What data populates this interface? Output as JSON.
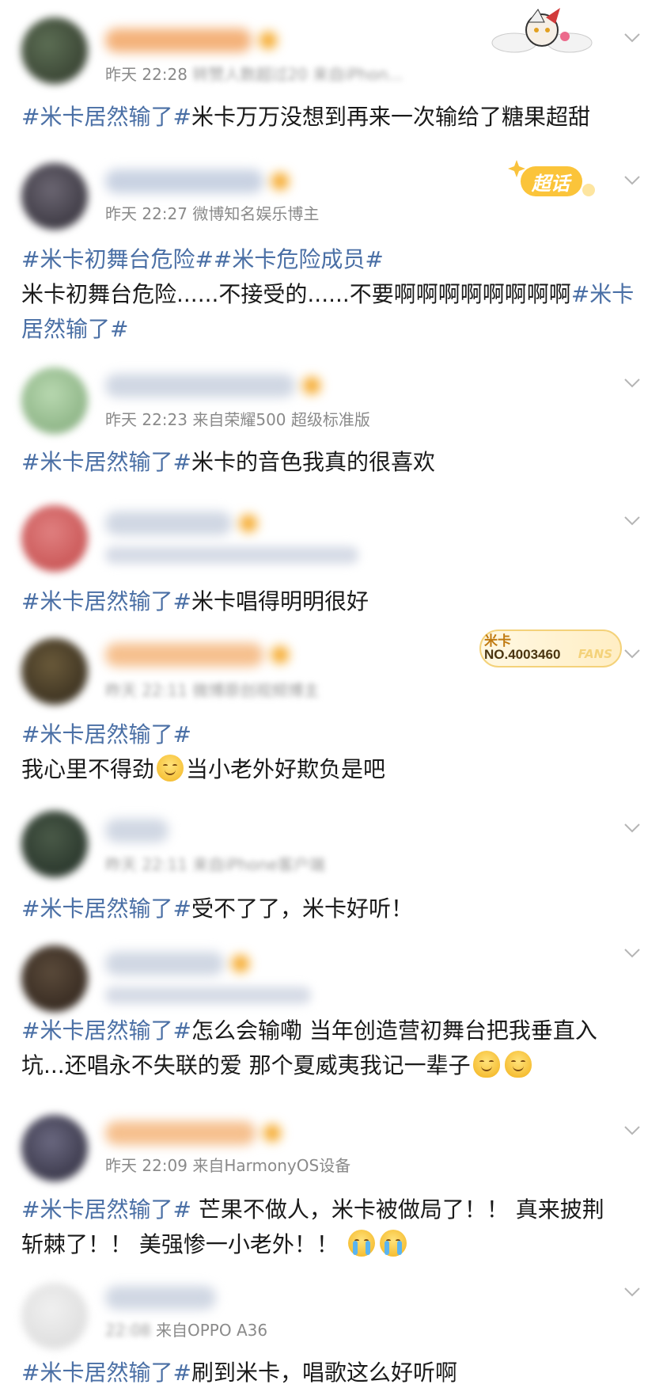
{
  "colors": {
    "hashtag": "#4a6fa5",
    "text": "#1a1a1a",
    "meta": "#8a8a8a",
    "vip_badge": "#f5a623"
  },
  "badges": {
    "chaohua": "超话",
    "fans_name": "米卡",
    "fans_no": "NO.4003460",
    "fans_logo": "FANS"
  },
  "posts": [
    {
      "time": "昨天 22:28",
      "meta_blur": "转赞人数超过20",
      "source": "来自iPhon...",
      "body": [
        [
          {
            "t": "#米卡居然输了#",
            "tag": true
          },
          {
            "t": "米卡万万没想到再来一次输给了糖果超甜"
          }
        ]
      ]
    },
    {
      "time": "昨天 22:27",
      "source": "微博知名娱乐博主",
      "body": [
        [
          {
            "t": "#米卡初舞台危险##米卡危险成员#",
            "tag": true
          }
        ],
        [
          {
            "t": "米卡初舞台危险......不接受的......不要啊啊啊啊啊啊啊啊"
          },
          {
            "t": "#米卡",
            "tag": true
          }
        ],
        [
          {
            "t": "居然输了#",
            "tag": true
          }
        ]
      ]
    },
    {
      "time": "昨天 22:23",
      "source": "来自荣耀500 超级标准版",
      "body": [
        [
          {
            "t": "#米卡居然输了#",
            "tag": true
          },
          {
            "t": "米卡的音色我真的很喜欢"
          }
        ]
      ]
    },
    {
      "body": [
        [
          {
            "t": "#米卡居然输了#",
            "tag": true
          },
          {
            "t": "米卡唱得明明很好"
          }
        ]
      ]
    },
    {
      "time": "昨天 22:11",
      "meta_blur": "微博原创视频博主",
      "body": [
        [
          {
            "t": "#米卡居然输了#",
            "tag": true
          }
        ],
        [
          {
            "t": "我心里不得劲"
          },
          {
            "emoji": "smile"
          },
          {
            "t": "当小老外好欺负是吧"
          }
        ]
      ]
    },
    {
      "time": "昨天 22:11",
      "meta_blur": "来自iPhone客户端",
      "body": [
        [
          {
            "t": "#米卡居然输了#",
            "tag": true
          },
          {
            "t": "受不了了，米卡好听！"
          }
        ]
      ]
    },
    {
      "body": [
        [
          {
            "t": "#米卡居然输了#",
            "tag": true
          },
          {
            "t": "怎么会输嘞 当年创造营初舞台把我垂直入"
          }
        ],
        [
          {
            "t": "坑...还唱永不失联的爱 那个夏威夷我记一辈子"
          },
          {
            "emoji": "drool"
          },
          {
            "emoji": "drool"
          }
        ]
      ]
    },
    {
      "time": "昨天 22:09",
      "source": "来自HarmonyOS设备",
      "body": [
        [
          {
            "t": "#米卡居然输了#",
            "tag": true
          },
          {
            "t": " 芒果不做人，米卡被做局了！！ 真来披荆"
          }
        ],
        [
          {
            "t": "斩棘了！！ 美强惨一小老外！！ "
          },
          {
            "emoji": "cry"
          },
          {
            "emoji": "cry"
          }
        ]
      ]
    },
    {
      "meta_blur": "22:08",
      "source": "来自OPPO A36",
      "body": [
        [
          {
            "t": "#米卡居然输了#",
            "tag": true
          },
          {
            "t": "刷到米卡，唱歌这么好听啊"
          }
        ]
      ]
    }
  ]
}
